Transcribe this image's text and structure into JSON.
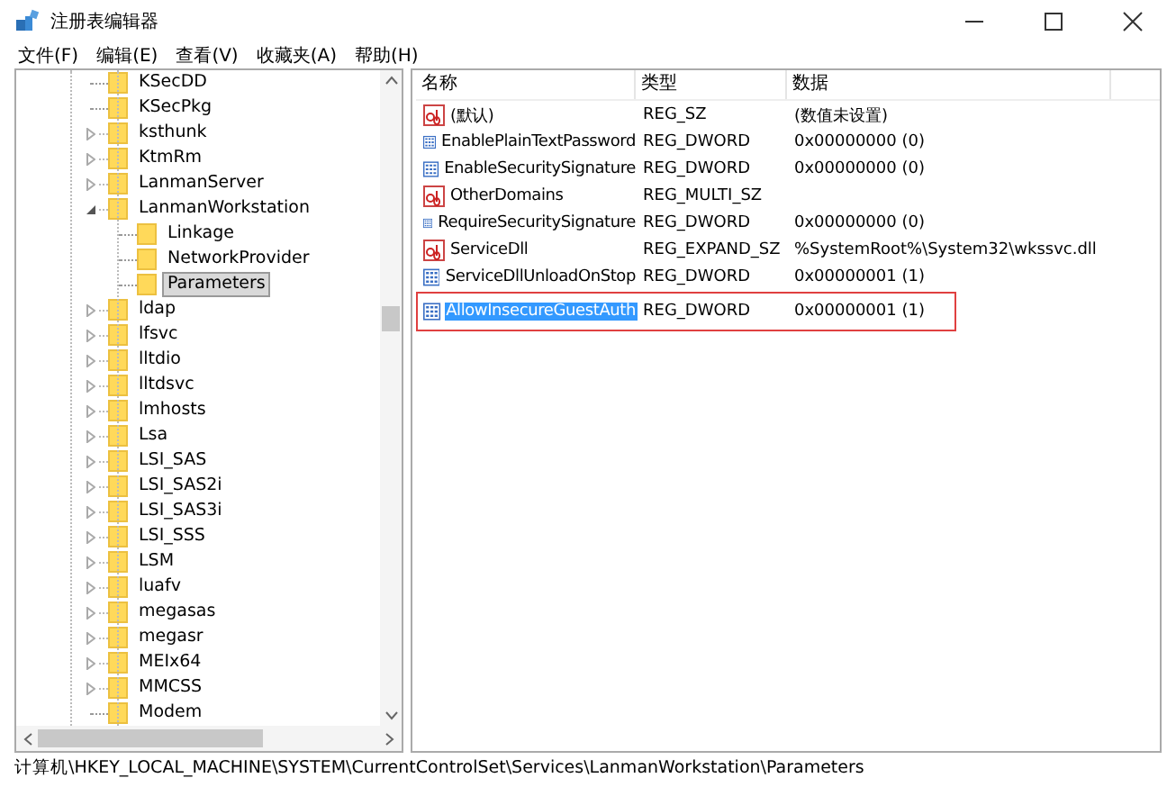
{
  "window": {
    "title": "注册表编辑器"
  },
  "menu": [
    "文件(F)",
    "编辑(E)",
    "查看(V)",
    "收藏夹(A)",
    "帮助(H)"
  ],
  "tree": {
    "items": [
      {
        "label": "KSecDD",
        "kind": "leaf",
        "selected": false
      },
      {
        "label": "KSecPkg",
        "kind": "leaf",
        "selected": false
      },
      {
        "label": "ksthunk",
        "kind": "branch",
        "expanded": false,
        "selected": false
      },
      {
        "label": "KtmRm",
        "kind": "branch",
        "expanded": false,
        "selected": false
      },
      {
        "label": "LanmanServer",
        "kind": "branch",
        "expanded": false,
        "selected": false
      },
      {
        "label": "LanmanWorkstation",
        "kind": "branch",
        "expanded": true,
        "selected": false,
        "children": [
          {
            "label": "Linkage",
            "kind": "leaf",
            "selected": false
          },
          {
            "label": "NetworkProvider",
            "kind": "leaf",
            "selected": false
          },
          {
            "label": "Parameters",
            "kind": "leaf",
            "selected": true
          }
        ]
      },
      {
        "label": "ldap",
        "kind": "branch",
        "expanded": false,
        "selected": false
      },
      {
        "label": "lfsvc",
        "kind": "branch",
        "expanded": false,
        "selected": false
      },
      {
        "label": "lltdio",
        "kind": "branch",
        "expanded": false,
        "selected": false
      },
      {
        "label": "lltdsvc",
        "kind": "branch",
        "expanded": false,
        "selected": false
      },
      {
        "label": "lmhosts",
        "kind": "branch",
        "expanded": false,
        "selected": false
      },
      {
        "label": "Lsa",
        "kind": "branch",
        "expanded": false,
        "selected": false
      },
      {
        "label": "LSI_SAS",
        "kind": "branch",
        "expanded": false,
        "selected": false
      },
      {
        "label": "LSI_SAS2i",
        "kind": "branch",
        "expanded": false,
        "selected": false
      },
      {
        "label": "LSI_SAS3i",
        "kind": "branch",
        "expanded": false,
        "selected": false
      },
      {
        "label": "LSI_SSS",
        "kind": "branch",
        "expanded": false,
        "selected": false
      },
      {
        "label": "LSM",
        "kind": "branch",
        "expanded": false,
        "selected": false
      },
      {
        "label": "luafv",
        "kind": "branch",
        "expanded": false,
        "selected": false
      },
      {
        "label": "megasas",
        "kind": "branch",
        "expanded": false,
        "selected": false
      },
      {
        "label": "megasr",
        "kind": "branch",
        "expanded": false,
        "selected": false
      },
      {
        "label": "MEIx64",
        "kind": "branch",
        "expanded": false,
        "selected": false
      },
      {
        "label": "MMCSS",
        "kind": "branch",
        "expanded": false,
        "selected": false
      },
      {
        "label": "Modem",
        "kind": "leaf",
        "selected": false
      }
    ]
  },
  "table": {
    "columns": [
      "名称",
      "类型",
      "数据"
    ],
    "rows": [
      {
        "kind": "string",
        "name": "(默认)",
        "type": "REG_SZ",
        "data": "(数值未设置)",
        "selected": false,
        "annotated": false
      },
      {
        "kind": "binary",
        "name": "EnablePlainTextPassword",
        "type": "REG_DWORD",
        "data": "0x00000000 (0)",
        "selected": false,
        "annotated": false
      },
      {
        "kind": "binary",
        "name": "EnableSecuritySignature",
        "type": "REG_DWORD",
        "data": "0x00000000 (0)",
        "selected": false,
        "annotated": false
      },
      {
        "kind": "string",
        "name": "OtherDomains",
        "type": "REG_MULTI_SZ",
        "selected": false,
        "annotated": false
      },
      {
        "kind": "binary",
        "name": "RequireSecuritySignature",
        "type": "REG_DWORD",
        "data": "0x00000000 (0)",
        "selected": false,
        "annotated": false
      },
      {
        "kind": "string",
        "name": "ServiceDll",
        "type": "REG_EXPAND_SZ",
        "data": "%SystemRoot%\\System32\\wkssvc.dll",
        "selected": false,
        "annotated": false
      },
      {
        "kind": "binary",
        "name": "ServiceDllUnloadOnStop",
        "type": "REG_DWORD",
        "data": "0x00000001 (1)",
        "selected": false,
        "annotated": false
      },
      {
        "kind": "binary",
        "name": "AllowInsecureGuestAuth",
        "type": "REG_DWORD",
        "data": "0x00000001 (1)",
        "selected": true,
        "annotated": true
      }
    ]
  },
  "status_bar": "计算机\\HKEY_LOCAL_MACHINE\\SYSTEM\\CurrentControlSet\\Services\\LanmanWorkstation\\Parameters"
}
